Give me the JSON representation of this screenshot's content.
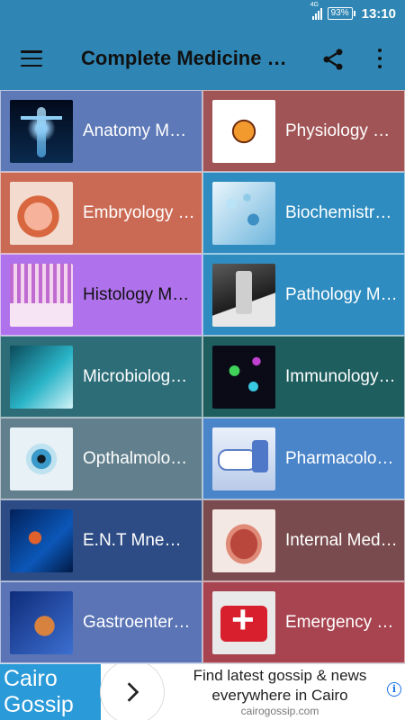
{
  "status_bar": {
    "network": "4G",
    "battery": "93%",
    "time": "13:10"
  },
  "app_bar": {
    "title": "Complete Medicine Mnemonics"
  },
  "categories": [
    {
      "label": "Anatomy Mnemonics",
      "bg": "#5d79b7",
      "icon": "anatomy-skeleton-icon"
    },
    {
      "label": "Physiology Mnemonics",
      "bg": "#a15456",
      "icon": "physiology-body-icon"
    },
    {
      "label": "Embryology Mnemonics",
      "bg": "#cb6a54",
      "icon": "embryo-icon"
    },
    {
      "label": "Biochemistry Mnemonics",
      "bg": "#2e8cc0",
      "icon": "molecule-icon"
    },
    {
      "label": "Histology Mnemonics",
      "bg": "#b072ec",
      "icon": "tissue-icon"
    },
    {
      "label": "Pathology Mnemonics",
      "bg": "#2e8cc0",
      "icon": "microscope-icon"
    },
    {
      "label": "Microbiology Mnemonics",
      "bg": "#2c6d78",
      "icon": "microbe-icon"
    },
    {
      "label": "Immunology Mnemonics",
      "bg": "#1e5e5e",
      "icon": "virus-icon"
    },
    {
      "label": "Opthalmology Mnemonics",
      "bg": "#617f8c",
      "icon": "eye-icon"
    },
    {
      "label": "Pharmacology Mnemonics",
      "bg": "#4a84c9",
      "icon": "pills-icon"
    },
    {
      "label": "E.N.T Mnemonics",
      "bg": "#2d4c86",
      "icon": "ear-nose-throat-icon"
    },
    {
      "label": "Internal Medicine Mnemonics",
      "bg": "#7a4b4e",
      "icon": "internal-organs-icon"
    },
    {
      "label": "Gastroenterology Mnemonics",
      "bg": "#5a74b6",
      "icon": "digestive-system-icon"
    },
    {
      "label": "Emergency Medicine Mnemonics",
      "bg": "#a84450",
      "icon": "first-aid-icon"
    }
  ],
  "ad": {
    "brand": "Cairo Gossip",
    "text": "Find latest gossip & news everywhere in Cairo",
    "url": "cairogossip.com"
  }
}
